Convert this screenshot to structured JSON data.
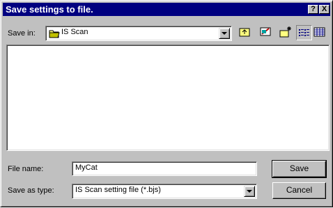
{
  "dialog": {
    "title": "Save settings to file.",
    "help_glyph": "?",
    "close_glyph": "X"
  },
  "save_in": {
    "label": "Save in:",
    "value": "IS Scan",
    "folder_icon": "folder-icon"
  },
  "toolbar": {
    "up_one_level": "up-folder-icon",
    "desktop": "desktop-icon",
    "new_folder": "new-folder-icon",
    "list_view": "list-view-icon",
    "details_view": "details-view-icon"
  },
  "file_name": {
    "label": "File name:",
    "value": "MyCat"
  },
  "save_as_type": {
    "label": "Save as type:",
    "value": "IS Scan setting file (*.bjs)"
  },
  "buttons": {
    "save": "Save",
    "cancel": "Cancel"
  },
  "colors": {
    "titlebar": "#000080",
    "face": "#c0c0c0",
    "window": "#ffffff"
  }
}
